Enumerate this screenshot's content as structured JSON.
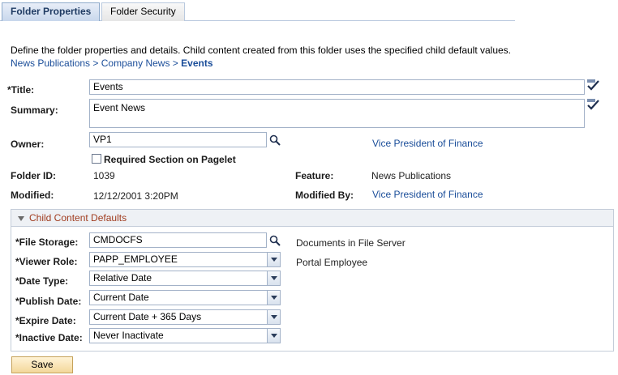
{
  "tabs": [
    {
      "label": "Folder Properties",
      "active": true
    },
    {
      "label": "Folder Security",
      "active": false
    }
  ],
  "description": "Define the folder properties and details. Child content created from this folder uses the specified child default values.",
  "breadcrumb": {
    "items": [
      "News Publications",
      "Company News",
      "Events"
    ],
    "separator": ">"
  },
  "form": {
    "title_label": "*Title:",
    "title_value": "Events",
    "summary_label": "Summary:",
    "summary_value": "Event News",
    "owner_label": "Owner:",
    "owner_value": "VP1",
    "owner_name": "Vice President of Finance",
    "required_section_label": "Required Section on Pagelet",
    "required_section_checked": false,
    "folder_id_label": "Folder ID:",
    "folder_id_value": "1039",
    "feature_label": "Feature:",
    "feature_value": "News Publications",
    "modified_label": "Modified:",
    "modified_value": "12/12/2001  3:20PM",
    "modified_by_label": "Modified By:",
    "modified_by_value": "Vice President of Finance"
  },
  "child_defaults": {
    "title": "Child Content Defaults",
    "file_storage_label": "*File Storage:",
    "file_storage_value": "CMDOCFS",
    "file_storage_desc": "Documents in File Server",
    "viewer_role_label": "*Viewer Role:",
    "viewer_role_value": "PAPP_EMPLOYEE",
    "viewer_role_desc": "Portal Employee",
    "date_type_label": "*Date Type:",
    "date_type_value": "Relative Date",
    "publish_date_label": "*Publish Date:",
    "publish_date_value": "Current Date",
    "expire_date_label": "*Expire Date:",
    "expire_date_value": "Current Date + 365 Days",
    "inactive_date_label": "*Inactive Date:",
    "inactive_date_value": "Never Inactivate"
  },
  "actions": {
    "save_label": "Save"
  },
  "colors": {
    "link": "#1a4d99",
    "group_title": "#a03c1f",
    "save_button": "#f3d79a"
  }
}
